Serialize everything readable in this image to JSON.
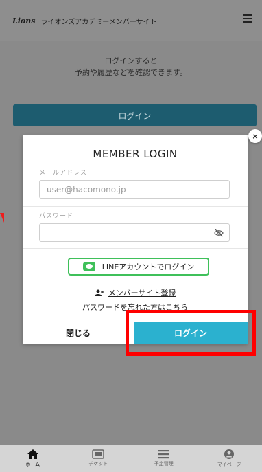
{
  "header": {
    "logo_text": "Lions",
    "site_title": "ライオンズアカデミーメンバーサイト"
  },
  "hero": {
    "line1": "ログインすると",
    "line2": "予約や履歴などを確認できます。",
    "login_button": "ログイン"
  },
  "modal": {
    "title": "MEMBER LOGIN",
    "email_label": "メールアドレス",
    "email_placeholder": "user@hacomono.jp",
    "password_label": "パスワード",
    "password_value": "",
    "line_login_label": "LINEアカウントでログイン",
    "register_label": "メンバーサイト登録",
    "forgot_label": "パスワードを忘れた方はこちら",
    "close_label": "閉じる",
    "login_label": "ログイン",
    "close_x": "×"
  },
  "nav": {
    "items": [
      {
        "label": "ホーム",
        "icon": "home-icon",
        "active": true
      },
      {
        "label": "チケット",
        "icon": "ticket-icon",
        "active": false
      },
      {
        "label": "予定管理",
        "icon": "list-icon",
        "active": false
      },
      {
        "label": "マイページ",
        "icon": "user-icon",
        "active": false
      }
    ]
  },
  "colors": {
    "accent": "#2bb1cf",
    "line_green": "#3fc05a",
    "highlight_red": "#ff0000"
  }
}
